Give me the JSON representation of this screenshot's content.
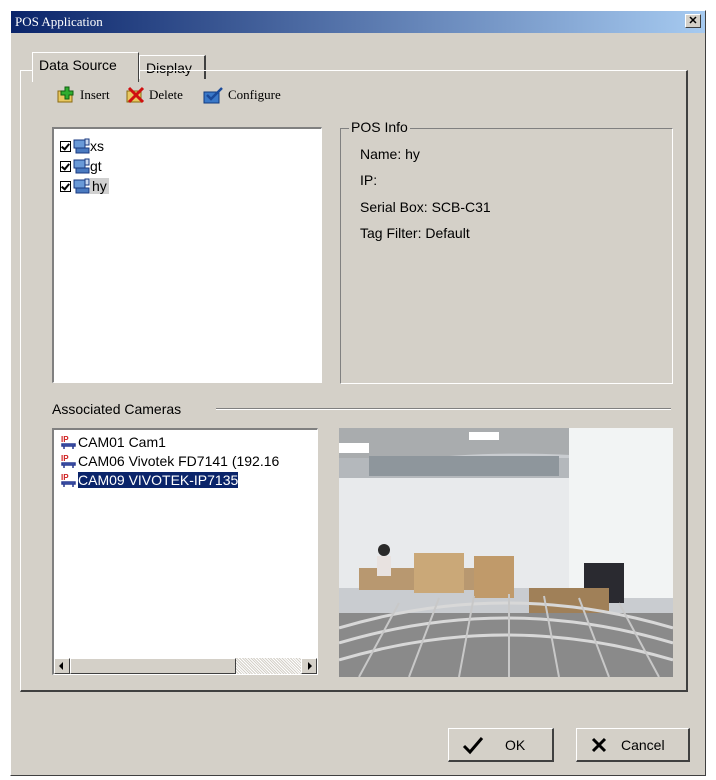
{
  "window": {
    "title": "POS Application",
    "close_icon": "close-icon"
  },
  "tabs": [
    {
      "label": "Data Source",
      "active": true
    },
    {
      "label": "Display",
      "active": false
    }
  ],
  "toolbar": {
    "insert_label": "Insert",
    "delete_label": "Delete",
    "configure_label": "Configure"
  },
  "pos_list": [
    {
      "label": "xs",
      "checked": true,
      "selected": false
    },
    {
      "label": "gt",
      "checked": true,
      "selected": false
    },
    {
      "label": "hy",
      "checked": true,
      "selected": true
    }
  ],
  "pos_info": {
    "group_label": "POS Info",
    "name_line": "Name: hy",
    "ip_line": "IP:",
    "serial_line": "Serial Box: SCB-C31",
    "tag_line": "Tag Filter: Default"
  },
  "cameras": {
    "group_label": "Associated Cameras",
    "items": [
      {
        "label": "CAM01 Cam1",
        "selected": false
      },
      {
        "label": "CAM06 Vivotek FD7141 (192.16",
        "selected": false
      },
      {
        "label": "CAM09 VIVOTEK-IP7135",
        "selected": true
      }
    ]
  },
  "buttons": {
    "ok_label": "OK",
    "cancel_label": "Cancel"
  },
  "colors": {
    "titlebar": "#0a246a",
    "selection": "#0a246a",
    "face": "#d4d0c8"
  }
}
